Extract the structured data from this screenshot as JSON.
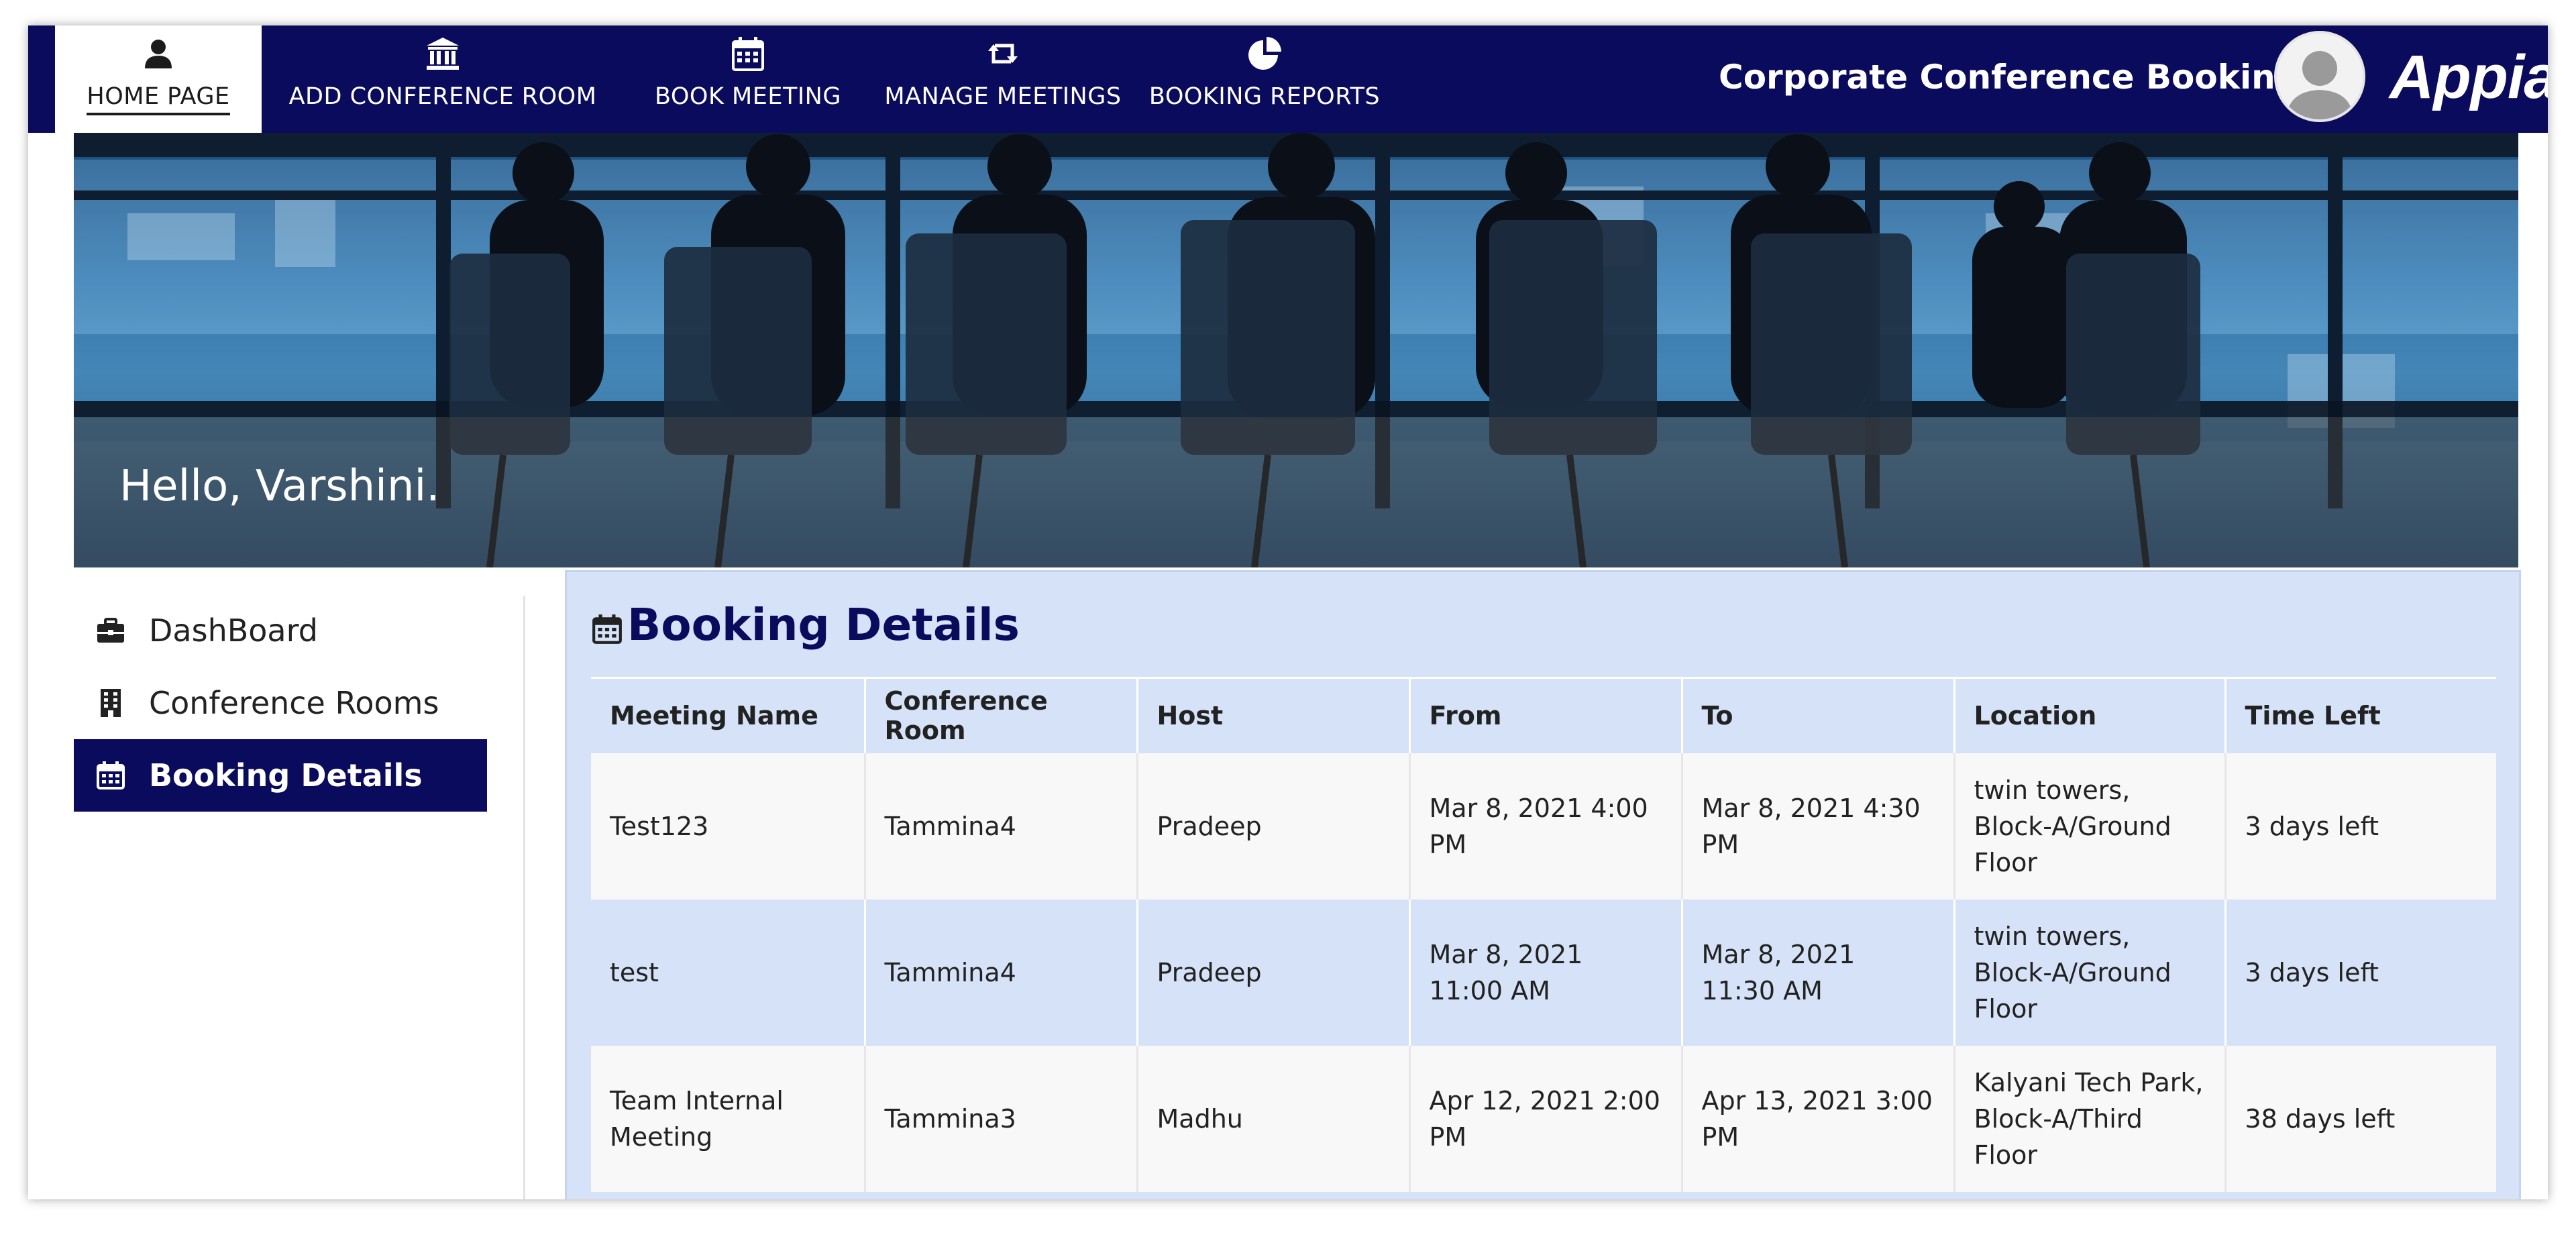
{
  "nav": {
    "tabs": [
      {
        "label": "HOME PAGE",
        "icon": "user-icon",
        "active": true
      },
      {
        "label": "ADD CONFERENCE ROOM",
        "icon": "bank-icon"
      },
      {
        "label": "BOOK MEETING",
        "icon": "calendar-icon"
      },
      {
        "label": "MANAGE MEETINGS",
        "icon": "retweet-icon"
      },
      {
        "label": "BOOKING REPORTS",
        "icon": "pie-chart-icon"
      }
    ],
    "site_title": "Corporate Conference Booking",
    "logo_text": "Appian"
  },
  "banner": {
    "greeting": "Hello, Varshini."
  },
  "sidebar": {
    "items": [
      {
        "label": "DashBoard",
        "icon": "briefcase-icon"
      },
      {
        "label": "Conference Rooms",
        "icon": "building-icon"
      },
      {
        "label": "Booking Details",
        "icon": "calendar-icon",
        "active": true
      }
    ]
  },
  "booking": {
    "title": "Booking Details",
    "columns": [
      "Meeting Name",
      "Conference Room",
      "Host",
      "From",
      "To",
      "Location",
      "Time Left"
    ],
    "rows": [
      [
        "Test123",
        "Tammina4",
        "Pradeep",
        "Mar 8, 2021 4:00 PM",
        "Mar 8, 2021 4:30 PM",
        "twin  towers, Block-A/Ground Floor",
        "3 days left"
      ],
      [
        "test",
        "Tammina4",
        "Pradeep",
        "Mar 8, 2021 11:00 AM",
        "Mar 8, 2021 11:30 AM",
        "twin  towers, Block-A/Ground Floor",
        "3 days left"
      ],
      [
        "Team Internal Meeting",
        "Tammina3",
        "Madhu",
        "Apr 12, 2021 2:00 PM",
        "Apr 13, 2021 3:00 PM",
        "Kalyani Tech Park, Block-A/Third Floor",
        "38 days left"
      ]
    ]
  },
  "colors": {
    "nav_bg": "#0b0b5e",
    "card_bg": "#d6e2f7",
    "title_color": "#0b0b5e"
  }
}
